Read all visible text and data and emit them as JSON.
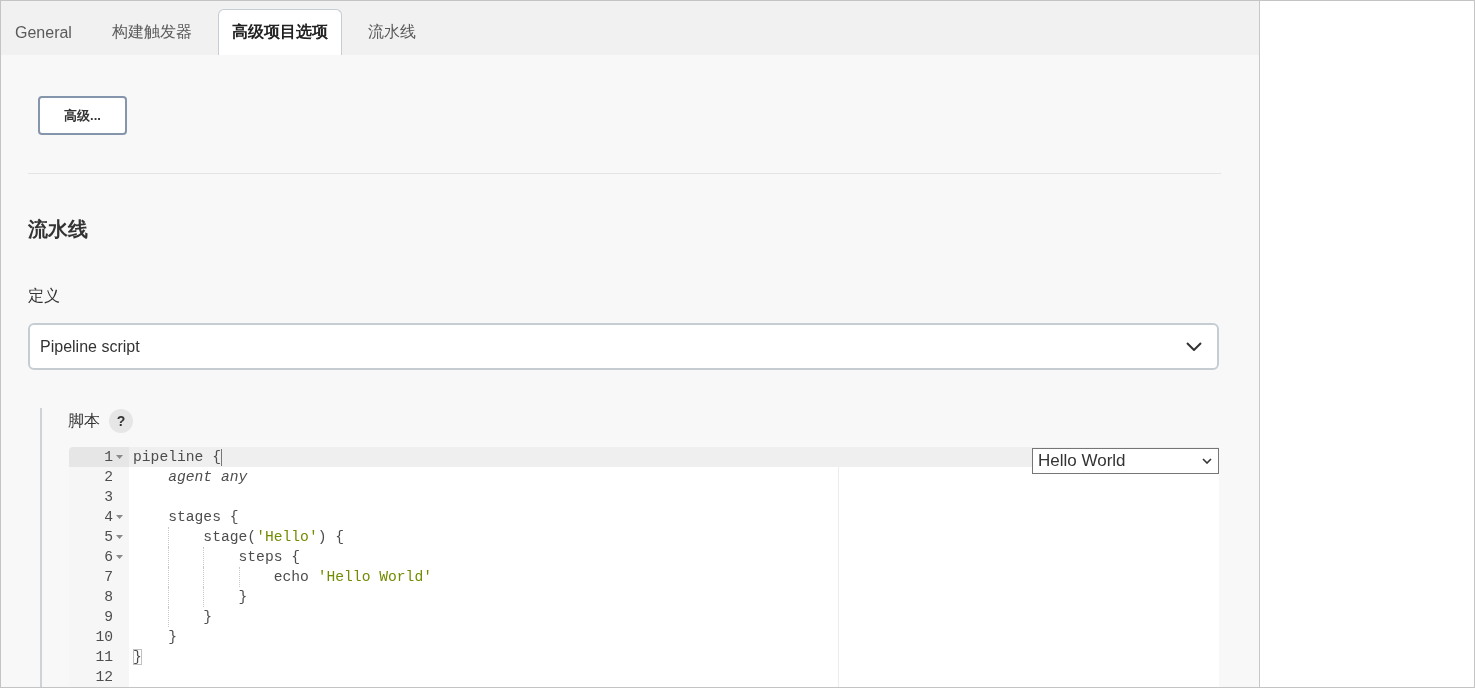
{
  "tabs": [
    {
      "label": "General",
      "selected": false
    },
    {
      "label": "构建触发器",
      "selected": false
    },
    {
      "label": "高级项目选项",
      "selected": true
    },
    {
      "label": "流水线",
      "selected": false
    }
  ],
  "advanced_button": {
    "label": "高级..."
  },
  "pipeline_section": {
    "title": "流水线",
    "definition": {
      "label": "定义",
      "value": "Pipeline script"
    },
    "script": {
      "label": "脚本",
      "help": "?",
      "sample_select": {
        "value": "Hello World"
      },
      "lines": [
        {
          "number": "1",
          "foldable": true,
          "active": true,
          "tokens": [
            {
              "kind": "plain",
              "text": "pipeline {"
            }
          ]
        },
        {
          "number": "2",
          "foldable": false,
          "active": false,
          "tokens": [
            {
              "kind": "variable",
              "text": "    agent any"
            }
          ]
        },
        {
          "number": "3",
          "foldable": false,
          "active": false
        },
        {
          "number": "4",
          "foldable": true,
          "active": false,
          "tokens": [
            {
              "kind": "plain",
              "text": "    stages {"
            }
          ]
        },
        {
          "number": "5",
          "foldable": true,
          "active": false,
          "tokens": [
            {
              "kind": "plain",
              "text": "        stage("
            },
            {
              "kind": "string",
              "text": "'Hello'"
            },
            {
              "kind": "plain",
              "text": ") {"
            }
          ]
        },
        {
          "number": "6",
          "foldable": true,
          "active": false,
          "tokens": [
            {
              "kind": "plain",
              "text": "            steps {"
            }
          ]
        },
        {
          "number": "7",
          "foldable": false,
          "active": false,
          "tokens": [
            {
              "kind": "plain",
              "text": "                echo "
            },
            {
              "kind": "string",
              "text": "'Hello World'"
            }
          ]
        },
        {
          "number": "8",
          "foldable": false,
          "active": false,
          "tokens": [
            {
              "kind": "plain",
              "text": "            }"
            }
          ]
        },
        {
          "number": "9",
          "foldable": false,
          "active": false,
          "tokens": [
            {
              "kind": "plain",
              "text": "        }"
            }
          ]
        },
        {
          "number": "10",
          "foldable": false,
          "active": false,
          "tokens": [
            {
              "kind": "plain",
              "text": "    }"
            }
          ]
        },
        {
          "number": "11",
          "foldable": false,
          "active": false,
          "tokens": [
            {
              "kind": "bracket",
              "text": "}"
            }
          ]
        },
        {
          "number": "12",
          "foldable": false,
          "active": false
        }
      ]
    }
  }
}
